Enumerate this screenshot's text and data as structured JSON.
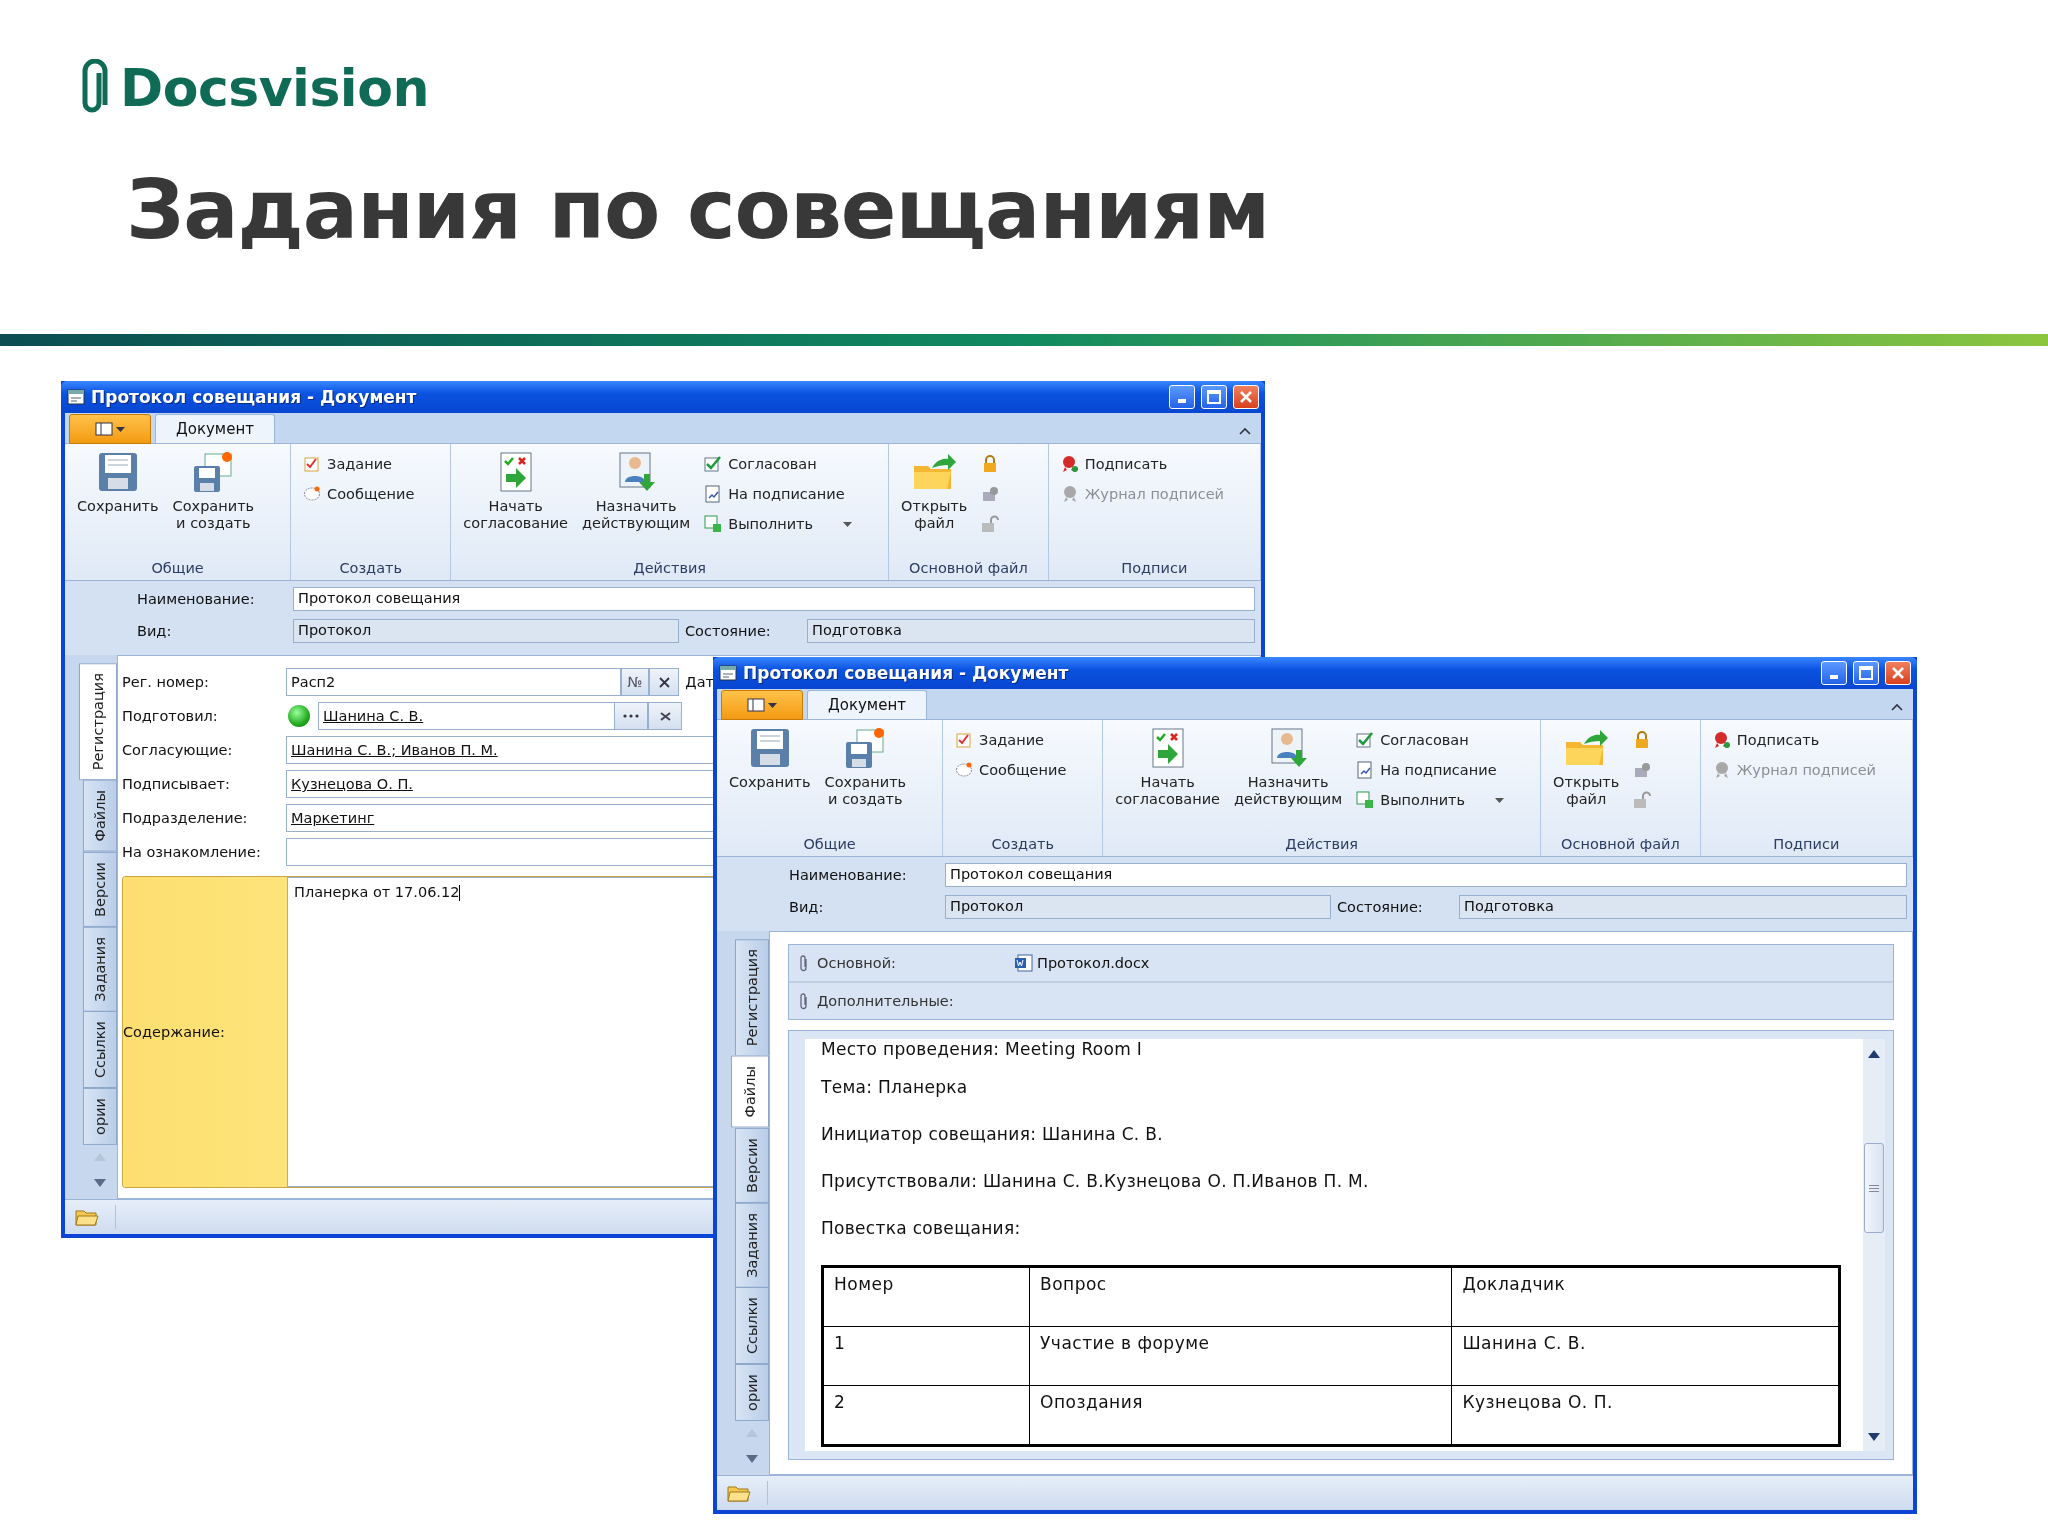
{
  "logo": {
    "text": "Docsvision"
  },
  "slide_title": "Задания по совещаниям",
  "windows": [
    {
      "kind": "registration",
      "title": "Протокол совещания - Документ",
      "ribbon_tab": "Документ",
      "ribbon_groups": [
        {
          "label": "Общие",
          "items": [
            {
              "kind": "large",
              "label": "Сохранить",
              "disabled": false
            },
            {
              "kind": "large",
              "label": "Сохранить\nи создать",
              "disabled": false
            }
          ]
        },
        {
          "label": "Создать",
          "items": [
            {
              "kind": "small",
              "label": "Задание",
              "disabled": false
            },
            {
              "kind": "small",
              "label": "Сообщение",
              "disabled": false
            }
          ]
        },
        {
          "label": "Действия",
          "items": [
            {
              "kind": "large",
              "label": "Начать\nсогласование",
              "disabled": false
            },
            {
              "kind": "large",
              "label": "Назначить\nдействующим",
              "disabled": false
            },
            {
              "kind": "small",
              "label": "Согласован",
              "disabled": false
            },
            {
              "kind": "small",
              "label": "На подписание",
              "disabled": false
            },
            {
              "kind": "split",
              "label": "Выполнить",
              "disabled": false
            }
          ]
        },
        {
          "label": "Основной файл",
          "items": [
            {
              "kind": "large",
              "label": "Открыть\nфайл",
              "disabled": false
            },
            {
              "kind": "icon",
              "disabled": false
            },
            {
              "kind": "icon",
              "disabled": true
            },
            {
              "kind": "icon",
              "disabled": true
            }
          ]
        },
        {
          "label": "Подписи",
          "items": [
            {
              "kind": "small",
              "label": "Подписать",
              "disabled": false
            },
            {
              "kind": "small",
              "label": "Журнал подписей",
              "disabled": true
            }
          ]
        }
      ],
      "header": {
        "name_label": "Наименование:",
        "name_value": "Протокол совещания",
        "kind_label": "Вид:",
        "kind_value": "Протокол",
        "state_label": "Состояние:",
        "state_value": "Подготовка"
      },
      "side_tabs": [
        {
          "label": "Регистрация",
          "selected": true
        },
        {
          "label": "Файлы",
          "selected": false
        },
        {
          "label": "Версии",
          "selected": false
        },
        {
          "label": "Задания",
          "selected": false
        },
        {
          "label": "Ссылки",
          "selected": false
        },
        {
          "label": "ории",
          "selected": false
        }
      ],
      "form": {
        "rows": [
          {
            "kind": "number",
            "label": "Рег. номер:",
            "value": "Расп2",
            "button": "№",
            "trailing_label": "Дат"
          },
          {
            "kind": "person",
            "label": "Подготовил:",
            "value": "Шанина С. В."
          },
          {
            "kind": "link",
            "label": "Согласующие:",
            "value": "Шанина С. В.; Иванов П. М."
          },
          {
            "kind": "link",
            "label": "Подписывает:",
            "value": "Кузнецова О. П."
          },
          {
            "kind": "link",
            "label": "Подразделение:",
            "value": "Маркетинг"
          },
          {
            "kind": "link",
            "label": "На ознакомление:"
          }
        ],
        "content_label": "Содержание:",
        "content_value": "Планерка от 17.06.12"
      }
    },
    {
      "kind": "files",
      "title": "Протокол совещания - Документ",
      "ribbon_tab": "Документ",
      "ribbon_groups": [
        {
          "label": "Общие",
          "items": [
            {
              "kind": "large",
              "label": "Сохранить",
              "disabled": false
            },
            {
              "kind": "large",
              "label": "Сохранить\nи создать",
              "disabled": false
            }
          ]
        },
        {
          "label": "Создать",
          "items": [
            {
              "kind": "small",
              "label": "Задание",
              "disabled": false
            },
            {
              "kind": "small",
              "label": "Сообщение",
              "disabled": false
            }
          ]
        },
        {
          "label": "Действия",
          "items": [
            {
              "kind": "large",
              "label": "Начать\nсогласование",
              "disabled": false
            },
            {
              "kind": "large",
              "label": "Назначить\nдействующим",
              "disabled": false
            },
            {
              "kind": "small",
              "label": "Согласован",
              "disabled": false
            },
            {
              "kind": "small",
              "label": "На подписание",
              "disabled": false
            },
            {
              "kind": "split",
              "label": "Выполнить",
              "disabled": false
            }
          ]
        },
        {
          "label": "Основной файл",
          "items": [
            {
              "kind": "large",
              "label": "Открыть\nфайл",
              "disabled": false
            },
            {
              "kind": "icon",
              "disabled": false
            },
            {
              "kind": "icon",
              "disabled": true
            },
            {
              "kind": "icon",
              "disabled": true
            }
          ]
        },
        {
          "label": "Подписи",
          "items": [
            {
              "kind": "small",
              "label": "Подписать",
              "disabled": false
            },
            {
              "kind": "small",
              "label": "Журнал подписей",
              "disabled": true
            }
          ]
        }
      ],
      "header": {
        "name_label": "Наименование:",
        "name_value": "Протокол совещания",
        "kind_label": "Вид:",
        "kind_value": "Протокол",
        "state_label": "Состояние:",
        "state_value": "Подготовка"
      },
      "side_tabs": [
        {
          "label": "Регистрация",
          "selected": false
        },
        {
          "label": "Файлы",
          "selected": true
        },
        {
          "label": "Версии",
          "selected": false
        },
        {
          "label": "Задания",
          "selected": false
        },
        {
          "label": "Ссылки",
          "selected": false
        },
        {
          "label": "ории",
          "selected": false
        }
      ],
      "files": [
        {
          "label": "Основной:",
          "file": "Протокол.docx"
        },
        {
          "label": "Дополнительные:"
        }
      ],
      "document": {
        "paragraphs": [
          "Место проведения: Meeting Room I",
          "Тема: Планерка",
          "Инициатор совещания: Шанина С. В.",
          "Присутствовали: Шанина С. В.Кузнецова О. П.Иванов П. М.",
          "Повестка совещания:"
        ],
        "table": {
          "columns": [
            "Номер",
            "Вопрос",
            "Докладчик"
          ],
          "rows": [
            [
              "1",
              "Участие в форуме",
              "Шанина С. В."
            ],
            [
              "2",
              "Опоздания",
              "Кузнецова О. П."
            ]
          ]
        }
      }
    }
  ]
}
